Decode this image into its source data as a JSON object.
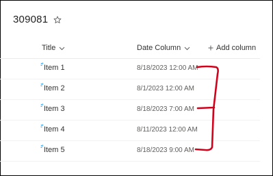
{
  "page": {
    "title": "309081"
  },
  "columns": {
    "title": "Title",
    "date": "Date Column",
    "add": "Add column"
  },
  "items": [
    {
      "title": "Item 1",
      "date": "8/18/2023 12:00 AM"
    },
    {
      "title": "Item 2",
      "date": "8/1/2023 12:00 AM"
    },
    {
      "title": "Item 3",
      "date": "8/18/2023 7:00 AM"
    },
    {
      "title": "Item 4",
      "date": "8/11/2023 12:00 AM"
    },
    {
      "title": "Item 5",
      "date": "8/18/2023 9:00 AM"
    }
  ],
  "colors": {
    "new_indicator": "#0078d4",
    "annotation": "#d0021b"
  },
  "icons": {
    "favorite": "star-icon",
    "sort": "chevron-down-icon",
    "add": "plus-icon",
    "new_item": "new-item-icon"
  }
}
